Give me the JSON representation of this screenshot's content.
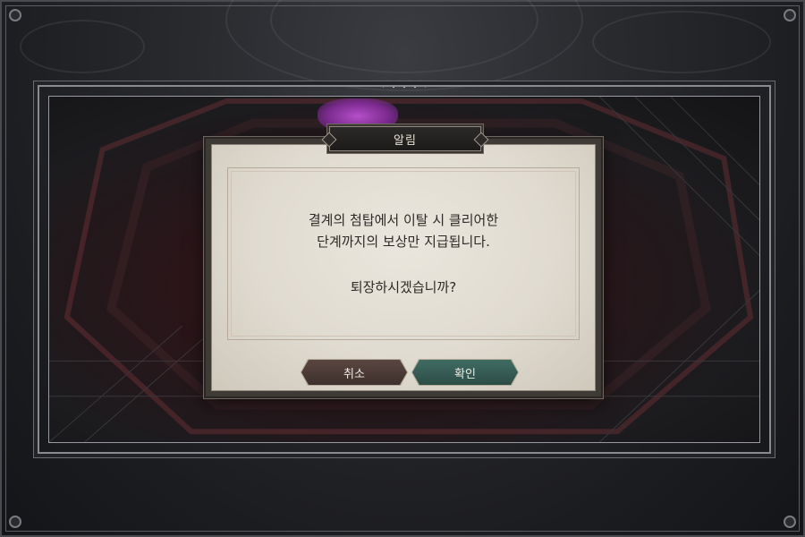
{
  "dialog": {
    "title": "알림",
    "message": "결계의 첨탑에서 이탈 시 클리어한\n단계까지의 보상만 지급됩니다.",
    "question": "퇴장하시겠습니까?",
    "cancel_label": "취소",
    "confirm_label": "확인"
  },
  "colors": {
    "cancel_button": "#4b3a36",
    "confirm_button": "#355c55",
    "paper": "#e3ded3",
    "crystal": "#9b3db0"
  }
}
